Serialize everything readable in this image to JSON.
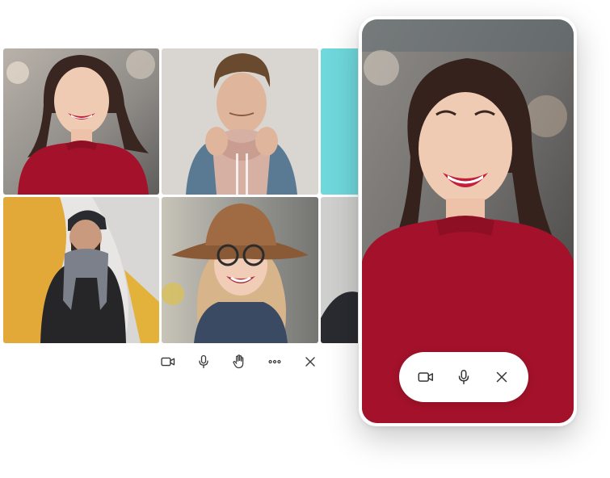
{
  "colors": {
    "accent_tile": "#6fd8dc",
    "icon": "#3a3a3a",
    "pill_bg": "#ffffff",
    "red_sweater": "#a3122a"
  },
  "grid": {
    "tiles": [
      {
        "participant": "woman-red-sweater"
      },
      {
        "participant": "man-denim-jacket"
      },
      {
        "participant": "accent-teal"
      },
      {
        "participant": "man-beanie-scarf"
      },
      {
        "participant": "woman-hat-glasses"
      },
      {
        "participant": "partial-person"
      }
    ]
  },
  "grid_toolbar": {
    "buttons": [
      {
        "icon": "video-camera-icon"
      },
      {
        "icon": "microphone-icon"
      },
      {
        "icon": "raise-hand-icon"
      },
      {
        "icon": "more-options-icon"
      },
      {
        "icon": "close-icon"
      }
    ]
  },
  "phone_call": {
    "participant": "woman-red-sweater",
    "controls": [
      {
        "icon": "video-camera-icon"
      },
      {
        "icon": "microphone-icon"
      },
      {
        "icon": "close-icon"
      }
    ]
  }
}
